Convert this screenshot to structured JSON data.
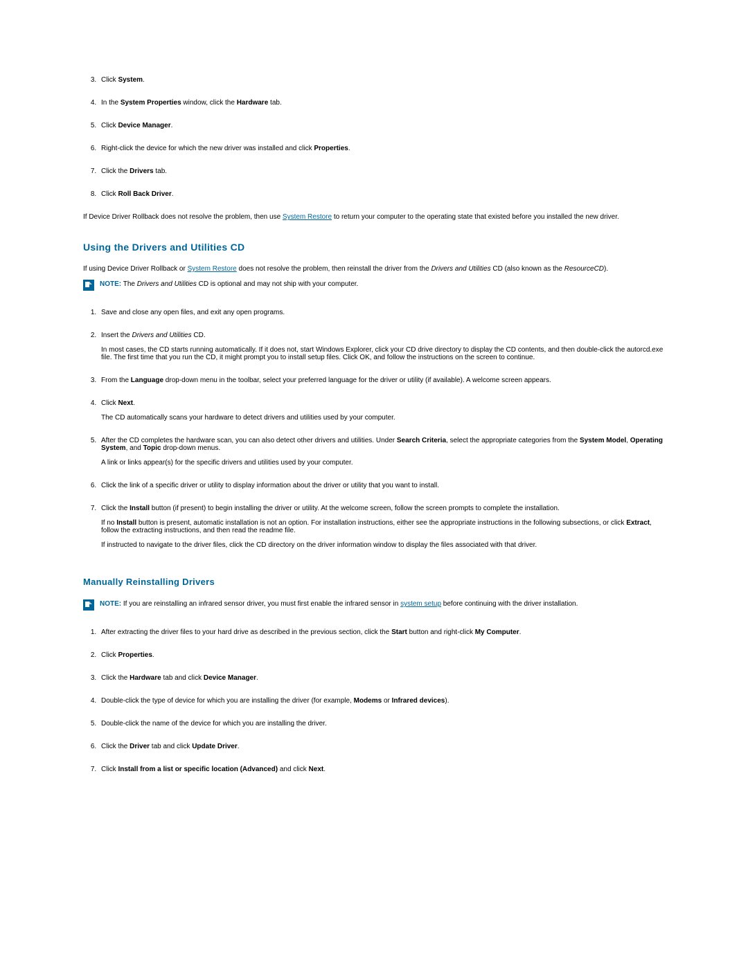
{
  "topSteps": [
    {
      "pre": "Click ",
      "bold": "System",
      "post": "."
    },
    {
      "pre": "In the ",
      "bold": "System Properties",
      "post": " window, click the ",
      "bold2": "Hardware",
      "post2": " tab."
    },
    {
      "pre": "Click ",
      "bold": "Device Manager",
      "post": "."
    },
    {
      "pre": "Right-click the device for which the new driver was installed and click ",
      "bold": "Properties",
      "post": "."
    },
    {
      "pre": "Click the ",
      "bold": "Drivers",
      "post": " tab."
    },
    {
      "pre": "Click ",
      "bold": "Roll Back Driver",
      "post": "."
    }
  ],
  "rollbackTail": {
    "pre": "If Device Driver Rollback does not resolve the problem, then use ",
    "link": "System Restore",
    "post": " to return your computer to the operating state that existed before you installed the new driver."
  },
  "headingCD": "Using the Drivers and Utilities CD",
  "cdIntro": {
    "pre": "If using Device Driver Rollback or ",
    "link": "System Restore",
    "mid": " does not resolve the problem, then reinstall the driver from the ",
    "ital": "Drivers and Utilities",
    "mid2": " CD (also known as the ",
    "ital2": "ResourceCD",
    "post": ")."
  },
  "noteCD": {
    "label": "NOTE:",
    "pre": " The ",
    "ital": "Drivers and Utilities",
    "post": " CD is optional and may not ship with your computer."
  },
  "cdSteps": {
    "s1": "Save and close any open files, and exit any open programs.",
    "s2": {
      "pre": "Insert the ",
      "ital": "Drivers and Utilities",
      "post": " CD."
    },
    "s2after": "In most cases, the CD starts running automatically. If it does not, start Windows Explorer, click your CD drive directory to display the CD contents, and then double-click the autorcd.exe file. The first time that you run the CD, it might prompt you to install setup files. Click OK, and follow the instructions on the screen to continue.",
    "s3": {
      "pre": "From the ",
      "bold": "Language",
      "post": " drop-down menu in the toolbar, select your preferred language for the driver or utility (if available). A welcome screen appears."
    },
    "s4": {
      "pre": "Click ",
      "bold": "Next",
      "post": "."
    },
    "s4after": "The CD automatically scans your hardware to detect drivers and utilities used by your computer.",
    "s5": {
      "pre": "After the CD completes the hardware scan, you can also detect other drivers and utilities. Under ",
      "bold": "Search Criteria",
      "mid": ", select the appropriate categories from the ",
      "bold2": "System Model",
      "mid2": ", ",
      "bold3": "Operating System",
      "mid3": ", and ",
      "bold4": "Topic",
      "post": " drop-down menus."
    },
    "s5after": "A link or links appear(s) for the specific drivers and utilities used by your computer.",
    "s6": "Click the link of a specific driver or utility to display information about the driver or utility that you want to install.",
    "s7": {
      "pre": "Click the ",
      "bold": "Install",
      "post": " button (if present) to begin installing the driver or utility. At the welcome screen, follow the screen prompts to complete the installation."
    },
    "s7after1": {
      "pre": "If no ",
      "bold": "Install",
      "mid": " button is present, automatic installation is not an option. For installation instructions, either see the appropriate instructions in the following subsections, or click ",
      "bold2": "Extract",
      "post": ", follow the extracting instructions, and then read the readme file."
    },
    "s7after2": "If instructed to navigate to the driver files, click the CD directory on the driver information window to display the files associated with that driver."
  },
  "headingManual": "Manually Reinstalling Drivers",
  "noteManual": {
    "label": "NOTE:",
    "pre": " If you are reinstalling an infrared sensor driver, you must first enable the infrared sensor in ",
    "link": "system setup",
    "post": " before continuing with the driver installation."
  },
  "manualSteps": {
    "s1": {
      "pre": "After extracting the driver files to your hard drive as described in the previous section, click the ",
      "bold": "Start",
      "mid": " button and right-click ",
      "bold2": "My Computer",
      "post": "."
    },
    "s2": {
      "pre": "Click ",
      "bold": "Properties",
      "post": "."
    },
    "s3": {
      "pre": "Click the ",
      "bold": "Hardware",
      "mid": " tab and click ",
      "bold2": "Device Manager",
      "post": "."
    },
    "s4": {
      "pre": "Double-click the type of device for which you are installing the driver (for example, ",
      "bold": "Modems",
      "mid": " or ",
      "bold2": "Infrared devices",
      "post": ")."
    },
    "s5": "Double-click the name of the device for which you are installing the driver.",
    "s6": {
      "pre": "Click the ",
      "bold": "Driver",
      "mid": " tab and click ",
      "bold2": "Update Driver",
      "post": "."
    },
    "s7": {
      "pre": "Click ",
      "bold": "Install from a list or specific location (Advanced)",
      "mid": " and click ",
      "bold2": "Next",
      "post": "."
    }
  }
}
